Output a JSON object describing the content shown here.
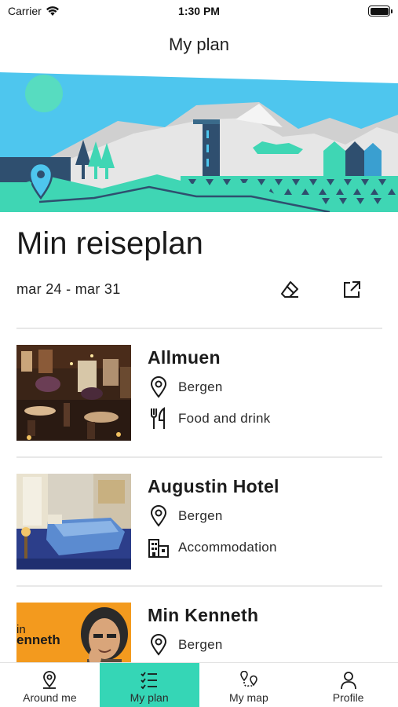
{
  "status_bar": {
    "carrier": "Carrier",
    "time": "1:30 PM"
  },
  "nav": {
    "title": "My plan"
  },
  "plan": {
    "title": "Min reiseplan",
    "date_range": "mar 24 - mar 31"
  },
  "items": [
    {
      "name": "Allmuen",
      "location": "Bergen",
      "category": "Food and drink",
      "category_icon": "fork-knife-icon"
    },
    {
      "name": "Augustin Hotel",
      "location": "Bergen",
      "category": "Accommodation",
      "category_icon": "building-icon"
    },
    {
      "name": "Min Kenneth",
      "location": "Bergen",
      "thumb_text": "enneth",
      "thumb_text_small": "in"
    }
  ],
  "tabs": [
    {
      "label": "Around me",
      "icon": "location-pin-icon",
      "active": false
    },
    {
      "label": "My plan",
      "icon": "checklist-icon",
      "active": true
    },
    {
      "label": "My map",
      "icon": "map-route-icon",
      "active": false
    },
    {
      "label": "Profile",
      "icon": "person-icon",
      "active": false
    }
  ],
  "colors": {
    "accent": "#35d6b6",
    "sky": "#4ec6ee",
    "mountain_light": "#e4e4e4",
    "mountain_dark": "#c8c8c8",
    "water": "#2f4f6f",
    "grass": "#3fd6b4"
  }
}
